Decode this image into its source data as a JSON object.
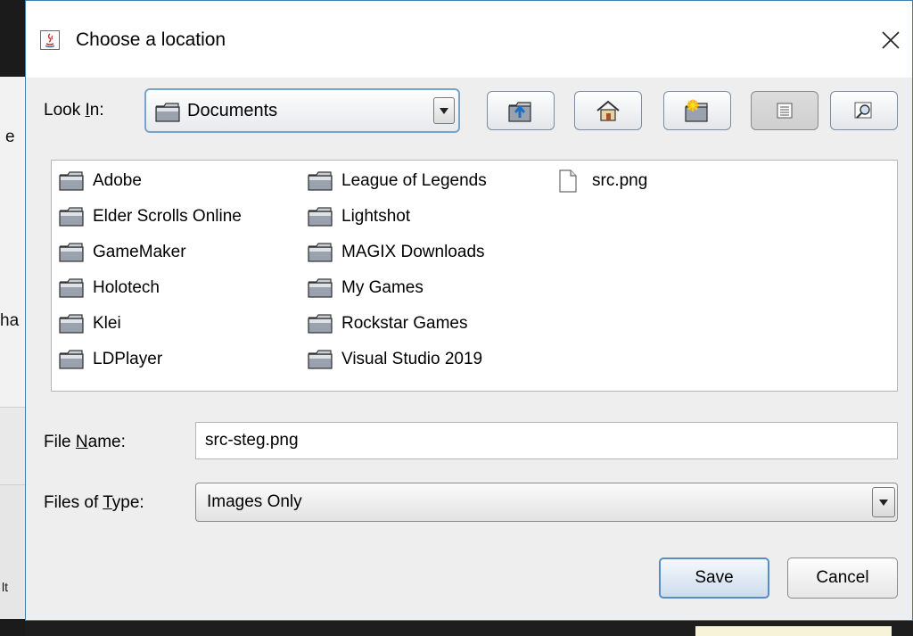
{
  "background": {
    "fragments": [
      "e",
      "ha",
      "lt"
    ]
  },
  "dialog": {
    "title": "Choose a location",
    "close_glyph": "✕"
  },
  "look_in": {
    "label_prefix": "Look ",
    "label_mnemonic": "I",
    "label_suffix": "n:",
    "value": "Documents"
  },
  "toolbar": {
    "buttons": [
      {
        "icon": "up-folder-icon"
      },
      {
        "icon": "home-icon"
      },
      {
        "icon": "new-folder-icon"
      },
      {
        "icon": "list-view-icon",
        "active": true
      },
      {
        "icon": "details-view-icon"
      }
    ]
  },
  "files": {
    "column1": [
      "Adobe",
      "Elder Scrolls Online",
      "GameMaker",
      "Holotech",
      "Klei",
      "LDPlayer"
    ],
    "column2": [
      "League of Legends",
      "Lightshot",
      "MAGIX Downloads",
      "My Games",
      "Rockstar Games",
      "Visual Studio 2019"
    ],
    "column3": [
      "src.png"
    ]
  },
  "file_name": {
    "label_prefix": "File ",
    "label_mnemonic": "N",
    "label_suffix": "ame:",
    "value": "src-steg.png"
  },
  "file_type": {
    "label_prefix": "Files of ",
    "label_mnemonic": "T",
    "label_suffix": "ype:",
    "value": "Images Only"
  },
  "buttons": {
    "save": "Save",
    "cancel": "Cancel"
  }
}
